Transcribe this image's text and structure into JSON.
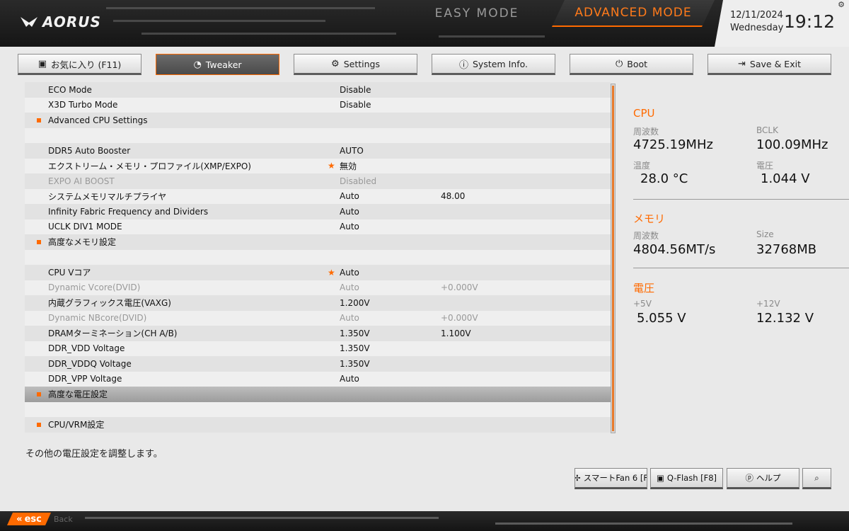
{
  "header": {
    "logo": "AORUS",
    "easy_mode": "EASY MODE",
    "advanced_mode": "ADVANCED MODE",
    "date": "12/11/2024",
    "weekday": "Wednesday",
    "time": "19:12"
  },
  "tabs": [
    {
      "label": "お気に入り (F11)",
      "icon": "star-folder-icon"
    },
    {
      "label": "Tweaker",
      "icon": "speedometer-icon",
      "active": true
    },
    {
      "label": "Settings",
      "icon": "gear-icon"
    },
    {
      "label": "System Info.",
      "icon": "info-icon"
    },
    {
      "label": "Boot",
      "icon": "power-icon"
    },
    {
      "label": "Save & Exit",
      "icon": "exit-icon"
    }
  ],
  "settings": [
    {
      "name": "ECO Mode",
      "value": "Disable",
      "value2": "",
      "bullet": false,
      "star": false,
      "dim": false
    },
    {
      "name": "X3D Turbo Mode",
      "value": "Disable",
      "value2": "",
      "bullet": false,
      "star": false,
      "dim": false
    },
    {
      "name": "Advanced CPU Settings",
      "value": "",
      "value2": "",
      "bullet": true,
      "star": false,
      "dim": false
    },
    {
      "name": "",
      "value": "",
      "value2": "",
      "bullet": false,
      "star": false,
      "dim": false
    },
    {
      "name": "DDR5 Auto Booster",
      "value": "AUTO",
      "value2": "",
      "bullet": false,
      "star": false,
      "dim": false
    },
    {
      "name": "エクストリーム・メモリ・プロファイル(XMP/EXPO)",
      "value": "無効",
      "value2": "",
      "bullet": false,
      "star": true,
      "dim": false
    },
    {
      "name": "EXPO AI BOOST",
      "value": "Disabled",
      "value2": "",
      "bullet": false,
      "star": false,
      "dim": true
    },
    {
      "name": "システムメモリマルチプライヤ",
      "value": "Auto",
      "value2": "48.00",
      "bullet": false,
      "star": false,
      "dim": false
    },
    {
      "name": "Infinity Fabric Frequency and Dividers",
      "value": "Auto",
      "value2": "",
      "bullet": false,
      "star": false,
      "dim": false
    },
    {
      "name": "UCLK DIV1 MODE",
      "value": "Auto",
      "value2": "",
      "bullet": false,
      "star": false,
      "dim": false
    },
    {
      "name": "高度なメモリ設定",
      "value": "",
      "value2": "",
      "bullet": true,
      "star": false,
      "dim": false
    },
    {
      "name": "",
      "value": "",
      "value2": "",
      "bullet": false,
      "star": false,
      "dim": false
    },
    {
      "name": "CPU Vコア",
      "value": "Auto",
      "value2": "",
      "bullet": false,
      "star": true,
      "dim": false
    },
    {
      "name": "Dynamic Vcore(DVID)",
      "value": "Auto",
      "value2": "+0.000V",
      "bullet": false,
      "star": false,
      "dim": true
    },
    {
      "name": "内蔵グラフィックス電圧(VAXG)",
      "value": "1.200V",
      "value2": "",
      "bullet": false,
      "star": false,
      "dim": false
    },
    {
      "name": "Dynamic NBcore(DVID)",
      "value": "Auto",
      "value2": "+0.000V",
      "bullet": false,
      "star": false,
      "dim": true
    },
    {
      "name": "DRAMターミネーション(CH A/B)",
      "value": "1.350V",
      "value2": "1.100V",
      "bullet": false,
      "star": false,
      "dim": false
    },
    {
      "name": "DDR_VDD Voltage",
      "value": "1.350V",
      "value2": "",
      "bullet": false,
      "star": false,
      "dim": false
    },
    {
      "name": "DDR_VDDQ Voltage",
      "value": "1.350V",
      "value2": "",
      "bullet": false,
      "star": false,
      "dim": false
    },
    {
      "name": "DDR_VPP Voltage",
      "value": "Auto",
      "value2": "",
      "bullet": false,
      "star": false,
      "dim": false
    },
    {
      "name": "高度な電圧設定",
      "value": "",
      "value2": "",
      "bullet": true,
      "star": false,
      "dim": false,
      "selected": true
    },
    {
      "name": "",
      "value": "",
      "value2": "",
      "bullet": false,
      "star": false,
      "dim": false
    },
    {
      "name": "CPU/VRM設定",
      "value": "",
      "value2": "",
      "bullet": true,
      "star": false,
      "dim": false
    }
  ],
  "panel": {
    "cpu": {
      "title": "CPU",
      "freq_label": "周波数",
      "freq": "4725.19MHz",
      "bclk_label": "BCLK",
      "bclk": "100.09MHz",
      "temp_label": "温度",
      "temp": "28.0 °C",
      "volt_label": "電圧",
      "volt": "1.044 V"
    },
    "memory": {
      "title": "メモリ",
      "freq_label": "周波数",
      "freq": "4804.56MT/s",
      "size_label": "Size",
      "size": "32768MB"
    },
    "voltage": {
      "title": "電圧",
      "v5_label": "+5V",
      "v5": "5.055 V",
      "v12_label": "+12V",
      "v12": "12.132 V"
    }
  },
  "help_text": "その他の電圧設定を調整します。",
  "footer": {
    "smartfan": "スマートFan 6 [F",
    "qflash": "Q-Flash [F8]",
    "help": "ヘルプ",
    "esc": "esc",
    "esc_sub": "Back"
  },
  "colors": {
    "accent": "#ff6a00",
    "background": "#e9e9e9",
    "header": "#1c1c1c"
  }
}
